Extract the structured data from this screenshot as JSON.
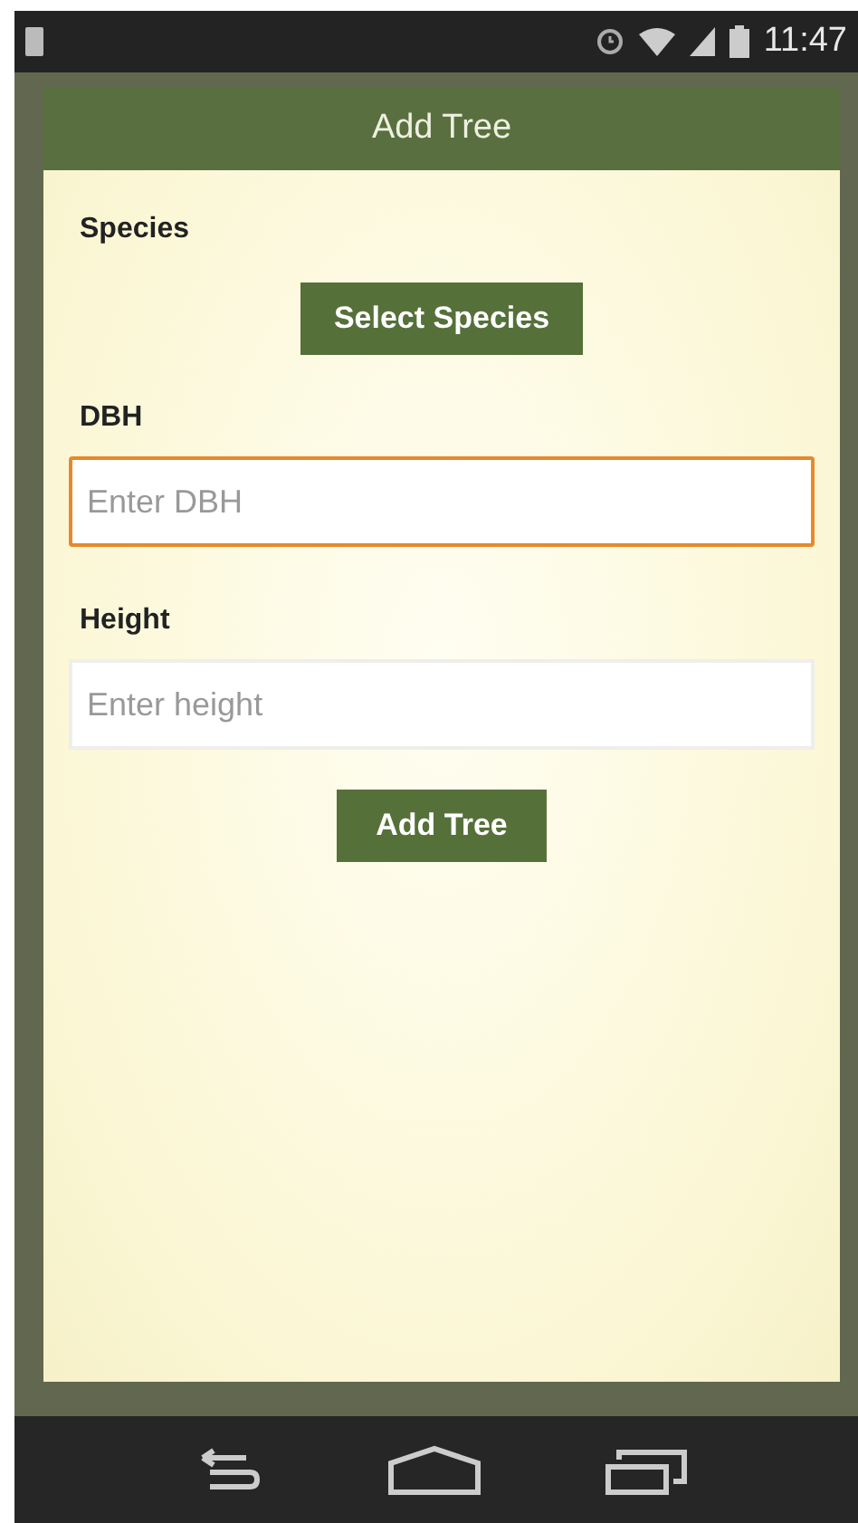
{
  "status_bar": {
    "time": "11:47"
  },
  "dialog": {
    "title": "Add Tree",
    "species": {
      "label": "Species",
      "button": "Select Species"
    },
    "fields": [
      {
        "label": "DBH",
        "placeholder": "Enter DBH",
        "focused": true
      },
      {
        "label": "Height",
        "placeholder": "Enter height",
        "focused": false
      }
    ],
    "submit": "Add Tree"
  }
}
